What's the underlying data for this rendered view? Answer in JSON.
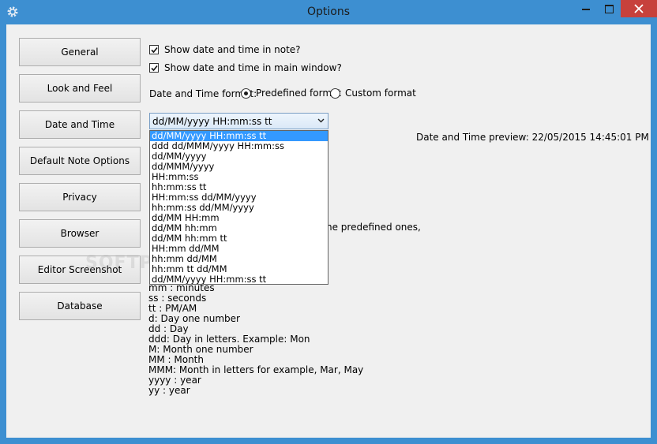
{
  "window": {
    "title": "Options",
    "accent_color": "#3d8fd1",
    "close_color": "#c7413c"
  },
  "nav": {
    "buttons": [
      {
        "label": "General"
      },
      {
        "label": "Look and Feel"
      },
      {
        "label": "Date and Time"
      },
      {
        "label": "Default Note Options"
      },
      {
        "label": "Privacy"
      },
      {
        "label": "Browser"
      },
      {
        "label": "Editor Screenshot"
      },
      {
        "label": "Database"
      }
    ]
  },
  "settings": {
    "show_in_note": {
      "label": "Show date and time in note?",
      "checked": true
    },
    "show_in_main": {
      "label": "Show date and time in main window?",
      "checked": true
    },
    "format_label": "Date and Time format:",
    "predefined_label": "Predefined format",
    "custom_label": "Custom format",
    "selected_mode": "predefined",
    "combo_value": "dd/MM/yyyy HH:mm:ss tt",
    "preview": "Date and Time preview: 22/05/2015 14:45:01 PM",
    "partial_hint": "he predefined ones,"
  },
  "dropdown": {
    "options": [
      "dd/MM/yyyy HH:mm:ss tt",
      "ddd dd/MMM/yyyy HH:mm:ss",
      "dd/MM/yyyy",
      "dd/MMM/yyyy",
      "HH:mm:ss",
      "hh:mm:ss tt",
      "HH:mm:ss dd/MM/yyyy",
      "hh:mm:ss dd/MM/yyyy",
      "dd/MM HH:mm",
      "dd/MM hh:mm",
      "dd/MM hh:mm tt",
      "HH:mm dd/MM",
      "hh:mm dd/MM",
      "hh:mm tt dd/MM",
      "dd/MM/yyyy HH:mm:ss tt"
    ],
    "selected_index": 0
  },
  "legend": [
    "mm : minutes",
    "ss : seconds",
    "tt : PM/AM",
    "d: Day one number",
    "dd : Day",
    "ddd: Day in letters. Example: Mon",
    "M: Month one number",
    "MM : Month",
    "MMM: Month in letters for example, Mar, May",
    "yyyy : year",
    "yy : year"
  ],
  "icons": {
    "app": "gear-icon",
    "minimize": "minimize-icon",
    "maximize": "maximize-icon",
    "close": "close-icon",
    "dropdown": "chevron-down-icon"
  }
}
